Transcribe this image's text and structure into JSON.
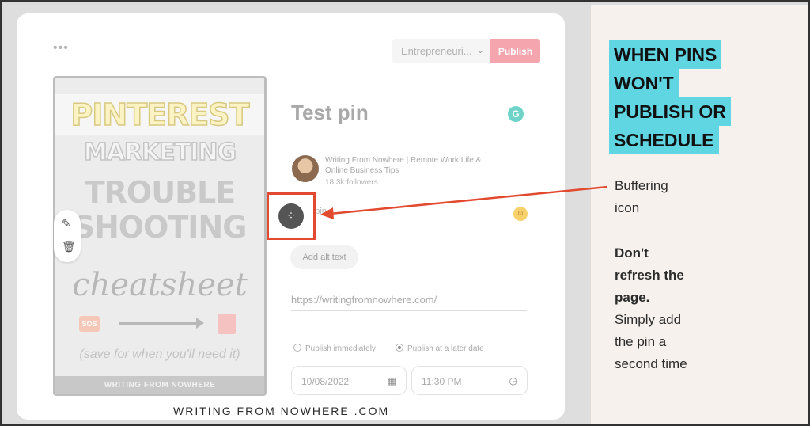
{
  "editor": {
    "menu_icon": "more-dots-icon",
    "board_select": {
      "value": "Entrepreneuri..."
    },
    "publish_label": "Publish",
    "pin_title": "Test pin",
    "grammarly_icon": "G",
    "account": {
      "name": "Writing From Nowhere | Remote Work Life & Online Business Tips",
      "followers": "18.3k followers"
    },
    "description_placeholder": "Test pin",
    "alt_text_label": "Add alt text",
    "destination_url": "https://writingfromnowhere.com/",
    "publish_options": {
      "immediately": "Publish immediately",
      "later": "Publish at a later date",
      "selected": "later"
    },
    "date_value": "10/08/2022",
    "time_value": "11:30 PM"
  },
  "pin_image": {
    "line1": "PINTEREST",
    "line2": "MARKETING",
    "line3": "TROUBLE",
    "line4": "SHOOTING",
    "script": "cheatsheet",
    "badge": "SOS",
    "save_note": "(save for when you'll need it)",
    "footer": "WRITING FROM NOWHERE"
  },
  "annotation": {
    "headline": [
      "WHEN PINS",
      "WON'T",
      "PUBLISH OR",
      "SCHEDULE"
    ],
    "buffer_label_1": "Buffering",
    "buffer_label_2": "icon",
    "tip_bold_1": "Don't",
    "tip_bold_2": "refresh the",
    "tip_bold_3": "page.",
    "tip_1": "Simply add",
    "tip_2": "the pin a",
    "tip_3": "second time",
    "highlight_color": "#5fd6e2",
    "callout_color": "#e24a2f"
  },
  "watermark": "WRITING FROM NOWHERE .COM"
}
